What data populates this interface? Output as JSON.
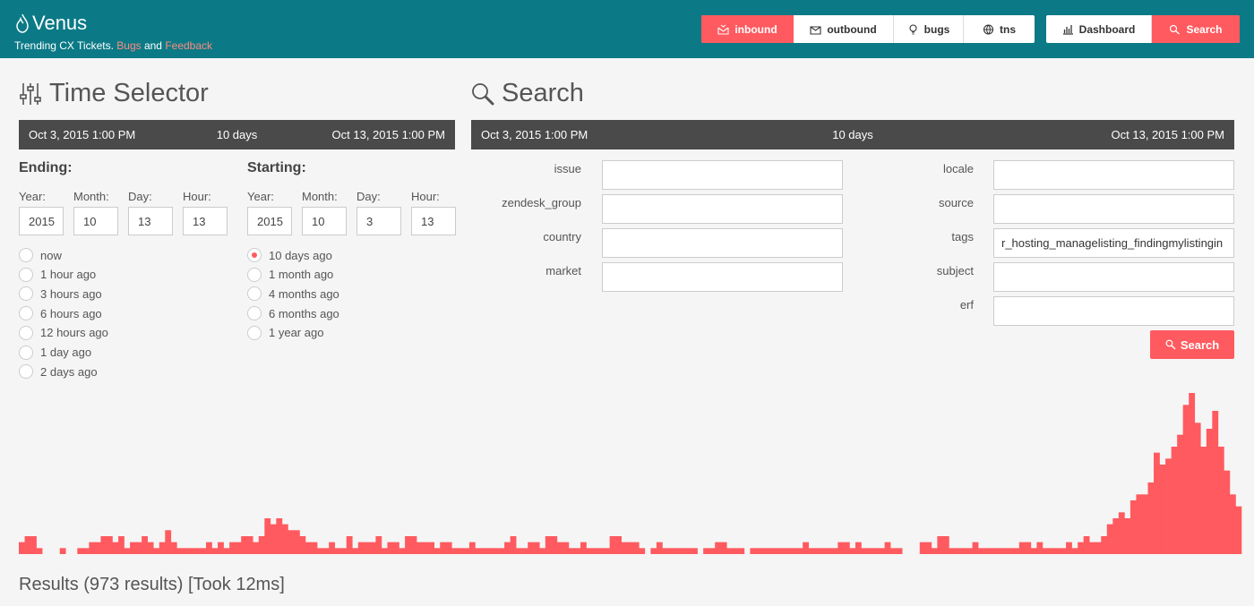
{
  "header": {
    "app_name": "Venus",
    "tagline_prefix": "Trending CX Tickets. ",
    "bugs_link": "Bugs",
    "and_text": " and ",
    "feedback_link": "Feedback",
    "nav": {
      "inbound": "inbound",
      "outbound": "outbound",
      "bugs": "bugs",
      "tns": "tns",
      "dashboard": "Dashboard",
      "search": "Search"
    },
    "active_tab": "inbound",
    "accent_color": "#ff5a5f",
    "header_color": "#0b7a86"
  },
  "time_selector": {
    "title": "Time Selector",
    "range": {
      "start": "Oct 3, 2015 1:00 PM",
      "duration": "10 days",
      "end": "Oct 13, 2015 1:00 PM"
    },
    "ending": {
      "heading": "Ending:",
      "labels": {
        "year": "Year:",
        "month": "Month:",
        "day": "Day:",
        "hour": "Hour:"
      },
      "year": "2015",
      "month": "10",
      "day": "13",
      "hour": "13",
      "options": [
        "now",
        "1 hour ago",
        "3 hours ago",
        "6 hours ago",
        "12 hours ago",
        "1 day ago",
        "2 days ago"
      ],
      "selected": null
    },
    "starting": {
      "heading": "Starting:",
      "labels": {
        "year": "Year:",
        "month": "Month:",
        "day": "Day:",
        "hour": "Hour:"
      },
      "year": "2015",
      "month": "10",
      "day": "3",
      "hour": "13",
      "options": [
        "10 days ago",
        "1 month ago",
        "4 months ago",
        "6 months ago",
        "1 year ago"
      ],
      "selected": "10 days ago"
    }
  },
  "search": {
    "title": "Search",
    "range": {
      "start": "Oct 3, 2015 1:00 PM",
      "duration": "10 days",
      "end": "Oct 13, 2015 1:00 PM"
    },
    "left_fields": [
      {
        "label": "issue",
        "value": ""
      },
      {
        "label": "zendesk_group",
        "value": ""
      },
      {
        "label": "country",
        "value": ""
      },
      {
        "label": "market",
        "value": ""
      }
    ],
    "right_fields": [
      {
        "label": "locale",
        "value": ""
      },
      {
        "label": "source",
        "value": ""
      },
      {
        "label": "tags",
        "value": "r_hosting_managelisting_findingmylistingin"
      },
      {
        "label": "subject",
        "value": ""
      },
      {
        "label": "erf",
        "value": ""
      }
    ],
    "button": "Search"
  },
  "chart_data": {
    "type": "bar",
    "series": [
      {
        "values": [
          2,
          3,
          3,
          1,
          0,
          0,
          0,
          1,
          0,
          0,
          1,
          1,
          2,
          2,
          3,
          3,
          2,
          3,
          1,
          2,
          2,
          3,
          2,
          1,
          2,
          4,
          2,
          1,
          1,
          1,
          1,
          1,
          2,
          1,
          2,
          1,
          2,
          2,
          3,
          3,
          2,
          3,
          6,
          5,
          6,
          5,
          4,
          4,
          3,
          2,
          2,
          1,
          1,
          2,
          1,
          1,
          3,
          1,
          2,
          2,
          2,
          3,
          1,
          2,
          2,
          1,
          3,
          3,
          2,
          2,
          2,
          1,
          2,
          2,
          1,
          1,
          1,
          2,
          1,
          1,
          1,
          1,
          1,
          2,
          3,
          1,
          1,
          2,
          2,
          1,
          3,
          3,
          2,
          2,
          1,
          1,
          2,
          1,
          1,
          1,
          1,
          3,
          3,
          2,
          2,
          2,
          1,
          0,
          1,
          2,
          1,
          1,
          1,
          1,
          1,
          1,
          0,
          1,
          1,
          2,
          2,
          1,
          1,
          1,
          0,
          1,
          1,
          1,
          1,
          1,
          1,
          1,
          1,
          1,
          2,
          1,
          1,
          1,
          1,
          1,
          2,
          2,
          1,
          2,
          1,
          1,
          1,
          1,
          2,
          1,
          1,
          0,
          0,
          0,
          2,
          2,
          1,
          3,
          3,
          1,
          1,
          1,
          1,
          2,
          1,
          1,
          1,
          1,
          1,
          1,
          1,
          2,
          2,
          1,
          2,
          1,
          1,
          1,
          1,
          2,
          1,
          2,
          3,
          2,
          2,
          3,
          5,
          6,
          7,
          6,
          9,
          10,
          10,
          12,
          17,
          15,
          16,
          18,
          20,
          25,
          27,
          22,
          18,
          21,
          24,
          18,
          14,
          10,
          8
        ]
      }
    ],
    "ylim": [
      0,
      27
    ],
    "color": "#ff5a5f"
  },
  "results": {
    "text": "Results (973 results) [Took 12ms]"
  }
}
